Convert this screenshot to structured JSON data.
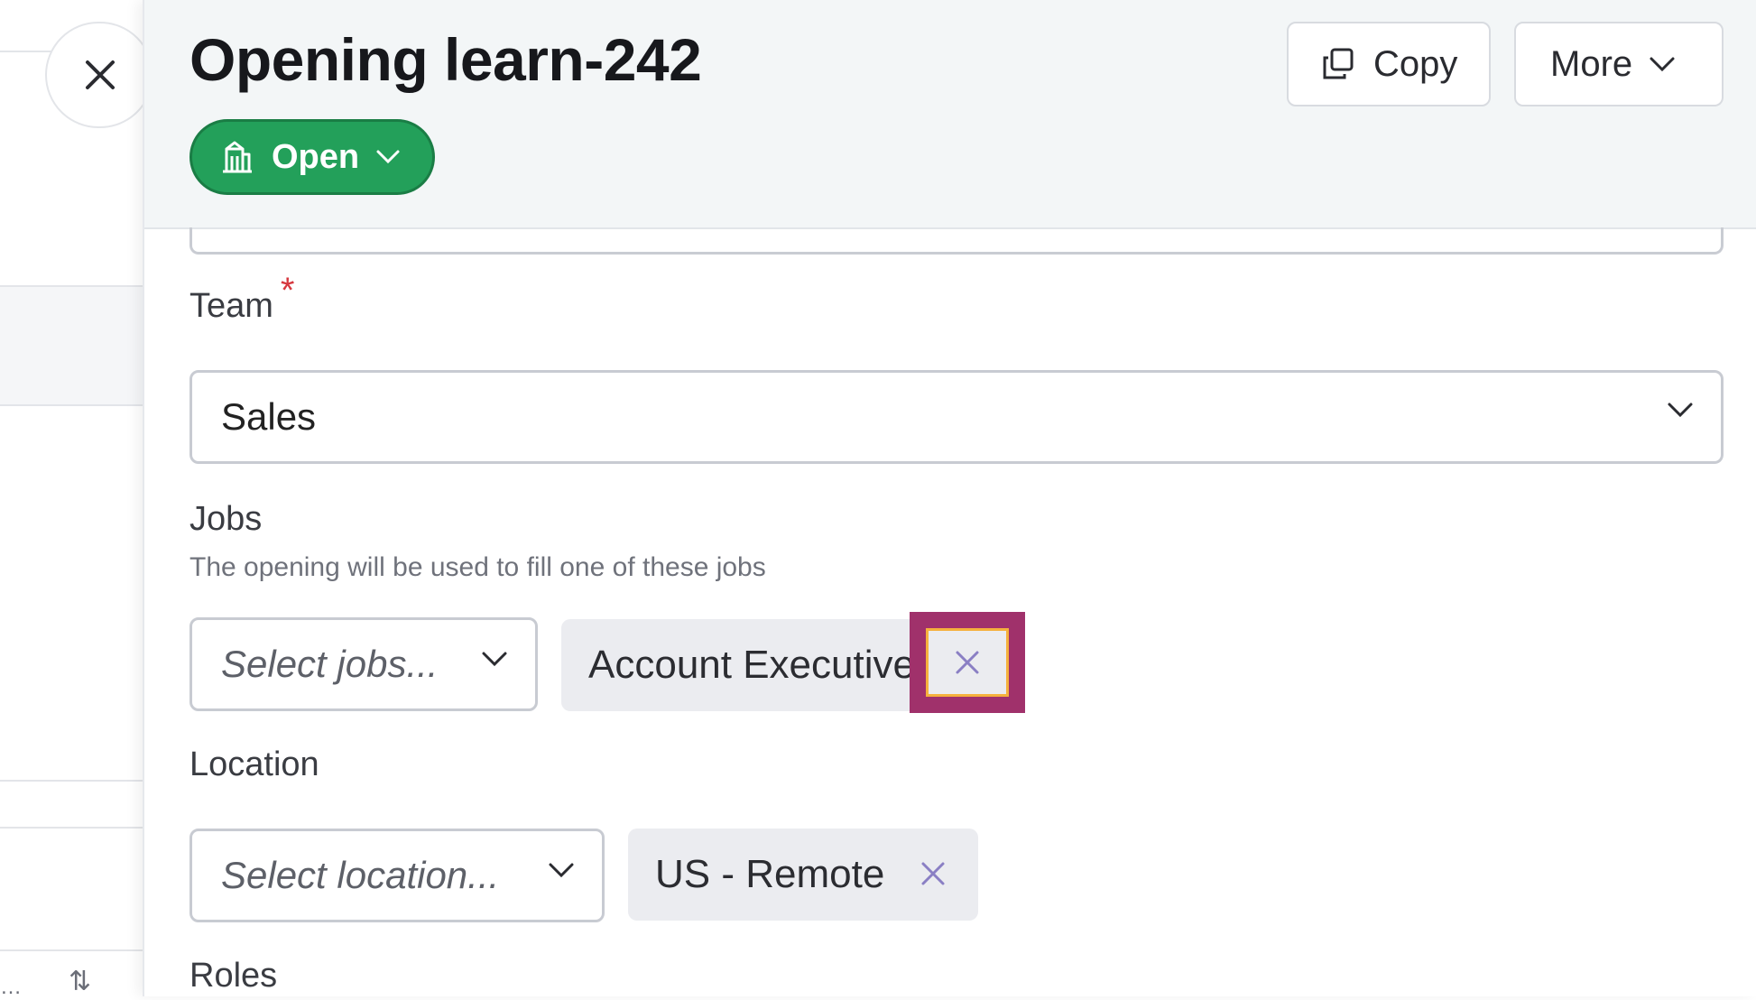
{
  "header": {
    "title": "Opening learn-242",
    "status_label": "Open",
    "copy_label": "Copy",
    "more_label": "More"
  },
  "form": {
    "team": {
      "label": "Team",
      "required_mark": "*",
      "value": "Sales"
    },
    "jobs": {
      "label": "Jobs",
      "help": "The opening will be used to fill one of these jobs",
      "placeholder": "Select jobs...",
      "selected": [
        "Account Executive"
      ]
    },
    "location": {
      "label": "Location",
      "placeholder": "Select location...",
      "selected": [
        "US - Remote"
      ]
    },
    "roles": {
      "label": "Roles"
    }
  },
  "colors": {
    "status_green": "#23a05a",
    "highlight": "#a0316b",
    "required": "#d6383f",
    "remove_icon": "#8a7fc4"
  }
}
